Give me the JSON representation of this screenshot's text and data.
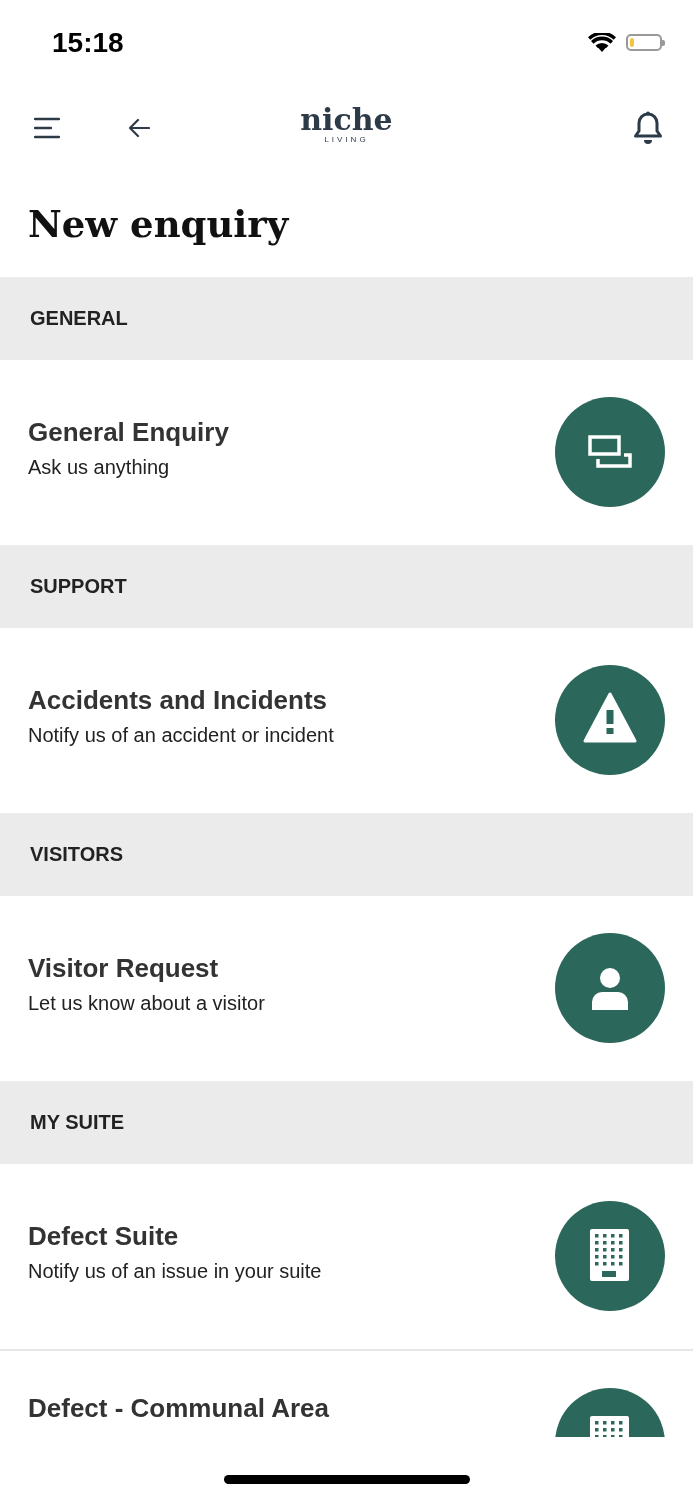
{
  "status_bar": {
    "time": "15:18",
    "battery": {
      "level": 0.15
    }
  },
  "header": {
    "logo": "niche",
    "logo_sub": "LIVING"
  },
  "title": "New enquiry",
  "sections": [
    {
      "header": "GENERAL",
      "items": [
        {
          "kind": "chat",
          "title": "General Enquiry",
          "subtitle": "Ask us anything"
        }
      ]
    },
    {
      "header": "SUPPORT",
      "items": [
        {
          "kind": "warning",
          "title": "Accidents and Incidents",
          "subtitle": "Notify us of an accident or incident"
        }
      ]
    },
    {
      "header": "VISITORS",
      "items": [
        {
          "kind": "person",
          "title": "Visitor Request",
          "subtitle": "Let us know about a visitor"
        }
      ]
    },
    {
      "header": "MY SUITE",
      "items": [
        {
          "kind": "building",
          "title": "Defect Suite",
          "subtitle": "Notify us of an issue in your suite"
        },
        {
          "kind": "building",
          "title": "Defect - Communal Area"
        }
      ]
    }
  ]
}
